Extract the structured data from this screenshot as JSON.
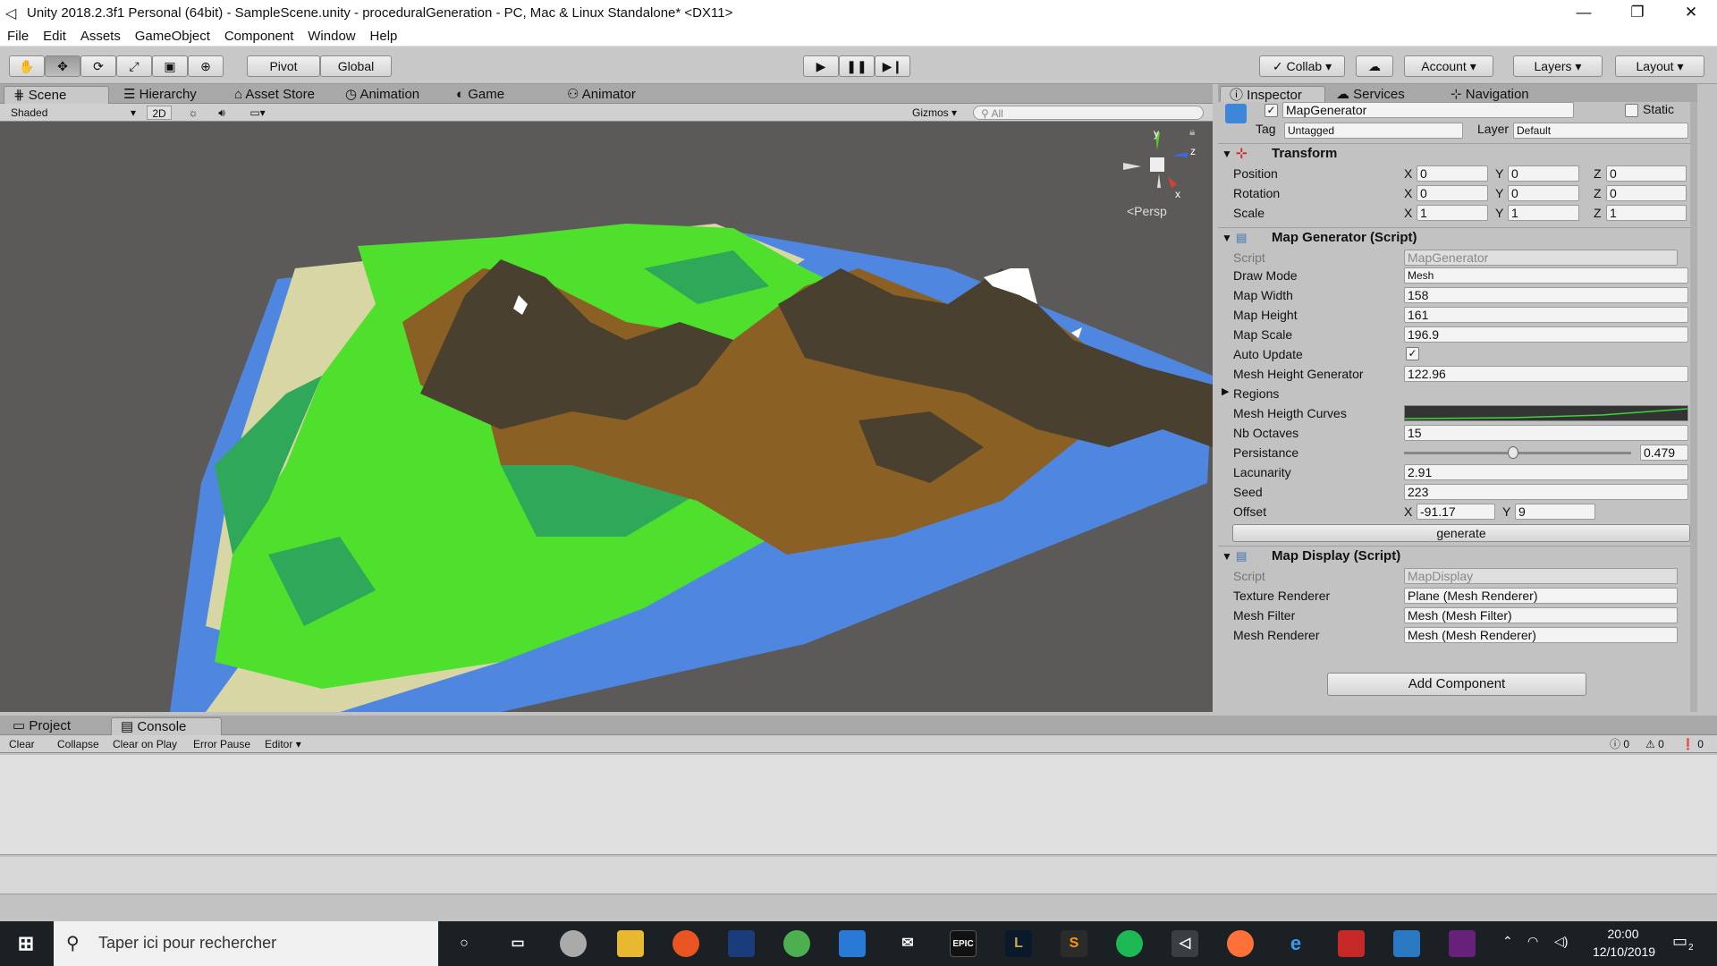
{
  "window": {
    "title": "Unity 2018.2.3f1 Personal (64bit) - SampleScene.unity - proceduralGeneration - PC, Mac & Linux Standalone* <DX11>",
    "minimize": "—",
    "restore": "❐",
    "close": "✕"
  },
  "menu": [
    "File",
    "Edit",
    "Assets",
    "GameObject",
    "Component",
    "Window",
    "Help"
  ],
  "toolbar": {
    "pivot": "Pivot",
    "global": "Global",
    "collab": "Collab",
    "account": "Account",
    "layers": "Layers",
    "layout": "Layout"
  },
  "scene_tabs": [
    "Scene",
    "Hierarchy",
    "Asset Store",
    "Animation",
    "Game",
    "Animator"
  ],
  "scene_bar": {
    "shading": "Shaded",
    "mode2d": "2D",
    "gizmos": "Gizmos",
    "search_placeholder": "All",
    "persp": "<Persp"
  },
  "inspector_tabs": [
    "Inspector",
    "Services",
    "Navigation"
  ],
  "object": {
    "name": "MapGenerator",
    "static": "Static",
    "tag_label": "Tag",
    "tag": "Untagged",
    "layer_label": "Layer",
    "layer": "Default"
  },
  "transform": {
    "title": "Transform",
    "position": {
      "label": "Position",
      "x": "0",
      "y": "0",
      "z": "0"
    },
    "rotation": {
      "label": "Rotation",
      "x": "0",
      "y": "0",
      "z": "0"
    },
    "scale": {
      "label": "Scale",
      "x": "1",
      "y": "1",
      "z": "1"
    }
  },
  "map_generator": {
    "title": "Map Generator (Script)",
    "script_label": "Script",
    "script": "MapGenerator",
    "draw_mode_label": "Draw Mode",
    "draw_mode": "Mesh",
    "map_width_label": "Map Width",
    "map_width": "158",
    "map_height_label": "Map Height",
    "map_height": "161",
    "map_scale_label": "Map Scale",
    "map_scale": "196.9",
    "auto_update_label": "Auto Update",
    "auto_update": true,
    "mesh_height_label": "Mesh Height Generator",
    "mesh_height": "122.96",
    "regions_label": "Regions",
    "curves_label": "Mesh Heigth Curves",
    "octaves_label": "Nb Octaves",
    "octaves": "15",
    "persistance_label": "Persistance",
    "persistance": "0.479",
    "persistance_fraction": 0.479,
    "lacunarity_label": "Lacunarity",
    "lacunarity": "2.91",
    "seed_label": "Seed",
    "seed": "223",
    "offset_label": "Offset",
    "offset_x": "-91.17",
    "offset_y": "9",
    "generate": "generate"
  },
  "map_display": {
    "title": "Map Display (Script)",
    "script_label": "Script",
    "script": "MapDisplay",
    "texture_label": "Texture Renderer",
    "texture": "Plane (Mesh Renderer)",
    "filter_label": "Mesh Filter",
    "filter": "Mesh (Mesh Filter)",
    "renderer_label": "Mesh Renderer",
    "renderer": "Mesh (Mesh Renderer)"
  },
  "add_component": "Add Component",
  "console": {
    "tabs": [
      "Project",
      "Console"
    ],
    "buttons": [
      "Clear",
      "Collapse",
      "Clear on Play",
      "Error Pause",
      "Editor"
    ],
    "counts": [
      "0",
      "0",
      "0"
    ]
  },
  "taskbar": {
    "search_placeholder": "Taper ici pour rechercher",
    "time": "20:00",
    "date": "12/10/2019",
    "notif": "2"
  },
  "gizmo_axes": {
    "y": "y",
    "x": "x",
    "z": "z"
  },
  "colors": {
    "water": "#4f86e0",
    "sand": "#d9d6a6",
    "grass": "#4ee02c",
    "forest": "#2fa85a",
    "dirt": "#8a6024",
    "rock": "#4a4030",
    "snow": "#ffffff"
  }
}
